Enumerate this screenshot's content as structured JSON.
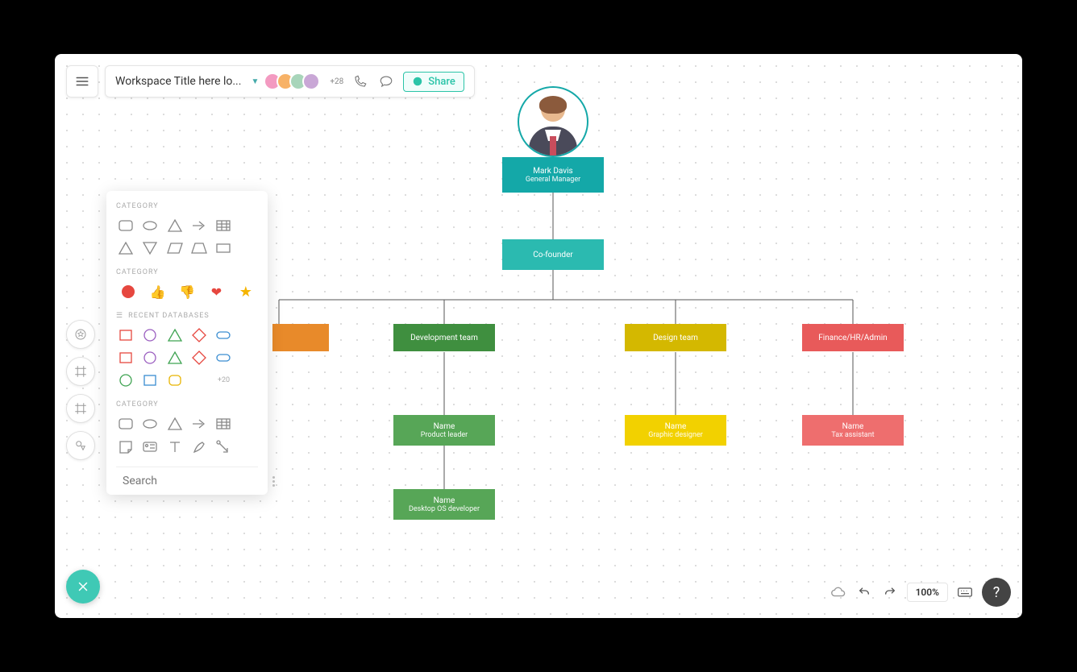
{
  "header": {
    "title": "Workspace Title here lo...",
    "plus_count": "+28",
    "share_label": "Share"
  },
  "panel": {
    "cat1": "CATEGORY",
    "cat2": "CATEGORY",
    "cat3": "RECENT DATABASES",
    "cat4": "CATEGORY",
    "more": "+20",
    "search_placeholder": "Search"
  },
  "org": {
    "root": {
      "name": "Mark    Davis",
      "role": "General    Manager"
    },
    "cofounder": {
      "label": "Co-founder"
    },
    "dept_dev": {
      "label": "Development    team"
    },
    "dept_design": {
      "label": "Design    team"
    },
    "dept_finance": {
      "label": "Finance/HR/Admin"
    },
    "product_leader": {
      "name": "Name",
      "role": "Product    leader"
    },
    "graphic_designer": {
      "name": "Name",
      "role": "Graphic    designer"
    },
    "tax_assistant": {
      "name": "Name",
      "role": "Tax    assistant"
    },
    "desktop_dev": {
      "name": "Name",
      "role": "Desktop    OS    developer"
    }
  },
  "footer": {
    "zoom": "100%"
  },
  "colors": {
    "teal": "#14a8a8",
    "green": "#4ea84e",
    "yellow": "#e7c800",
    "red": "#e85a5a",
    "orange": "#e88a2a",
    "mint": "#3fc9b5"
  }
}
